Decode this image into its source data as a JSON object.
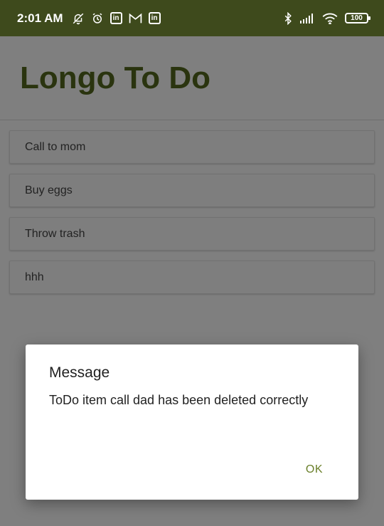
{
  "status_bar": {
    "time": "2:01 AM",
    "left_icons": [
      "notifications-off-icon",
      "alarm-icon",
      "linkedin-icon",
      "gmail-icon",
      "linkedin-icon"
    ],
    "right_icons": [
      "bluetooth-icon",
      "signal-icon",
      "wifi-icon",
      "battery-icon"
    ],
    "linkedin_glyph": "in",
    "battery_level": "100"
  },
  "app": {
    "title": "Longo To Do",
    "title_color": "#55681f",
    "todos": [
      {
        "label": "Call to mom"
      },
      {
        "label": "Buy eggs"
      },
      {
        "label": "Throw trash"
      },
      {
        "label": "hhh"
      }
    ]
  },
  "dialog": {
    "title": "Message",
    "message": "ToDo item call dad has been deleted correctly",
    "ok_label": "OK",
    "accent": "#6a7f2a"
  }
}
